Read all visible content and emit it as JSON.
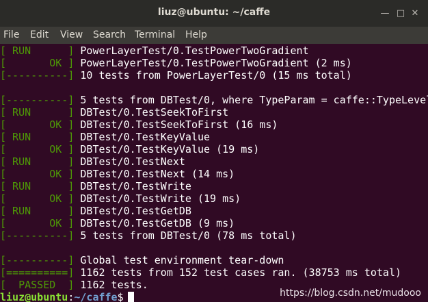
{
  "window": {
    "title": "liuz@ubuntu: ~/caffe"
  },
  "menu": [
    "File",
    "Edit",
    "View",
    "Search",
    "Terminal",
    "Help"
  ],
  "colors": {
    "background": "#300a24",
    "tag": "#4e9a06",
    "text": "#ffffff",
    "prompt_user": "#8ae234",
    "prompt_path": "#729fcf"
  },
  "lines": [
    {
      "tag": "[ RUN      ]",
      "text": " PowerLayerTest/0.TestPowerTwoGradient"
    },
    {
      "tag": "[       OK ]",
      "text": " PowerLayerTest/0.TestPowerTwoGradient (2 ms)"
    },
    {
      "tag": "[----------]",
      "text": " 10 tests from PowerLayerTest/0 (15 ms total)"
    },
    {
      "tag": "",
      "text": ""
    },
    {
      "tag": "[----------]",
      "text": " 5 tests from DBTest/0, where TypeParam = caffe::TypeLevel"
    },
    {
      "tag": "[ RUN      ]",
      "text": " DBTest/0.TestSeekToFirst"
    },
    {
      "tag": "[       OK ]",
      "text": " DBTest/0.TestSeekToFirst (16 ms)"
    },
    {
      "tag": "[ RUN      ]",
      "text": " DBTest/0.TestKeyValue"
    },
    {
      "tag": "[       OK ]",
      "text": " DBTest/0.TestKeyValue (19 ms)"
    },
    {
      "tag": "[ RUN      ]",
      "text": " DBTest/0.TestNext"
    },
    {
      "tag": "[       OK ]",
      "text": " DBTest/0.TestNext (14 ms)"
    },
    {
      "tag": "[ RUN      ]",
      "text": " DBTest/0.TestWrite"
    },
    {
      "tag": "[       OK ]",
      "text": " DBTest/0.TestWrite (19 ms)"
    },
    {
      "tag": "[ RUN      ]",
      "text": " DBTest/0.TestGetDB"
    },
    {
      "tag": "[       OK ]",
      "text": " DBTest/0.TestGetDB (9 ms)"
    },
    {
      "tag": "[----------]",
      "text": " 5 tests from DBTest/0 (78 ms total)"
    },
    {
      "tag": "",
      "text": ""
    },
    {
      "tag": "[----------]",
      "text": " Global test environment tear-down"
    },
    {
      "tag": "[==========]",
      "text": " 1162 tests from 152 test cases ran. (38753 ms total)"
    },
    {
      "tag": "[  PASSED  ]",
      "text": " 1162 tests."
    }
  ],
  "prompt": {
    "user": "liuz@ubuntu",
    "sep": ":",
    "path": "~/caffe",
    "symbol": "$"
  },
  "watermark": "https://blog.csdn.net/mudooo"
}
